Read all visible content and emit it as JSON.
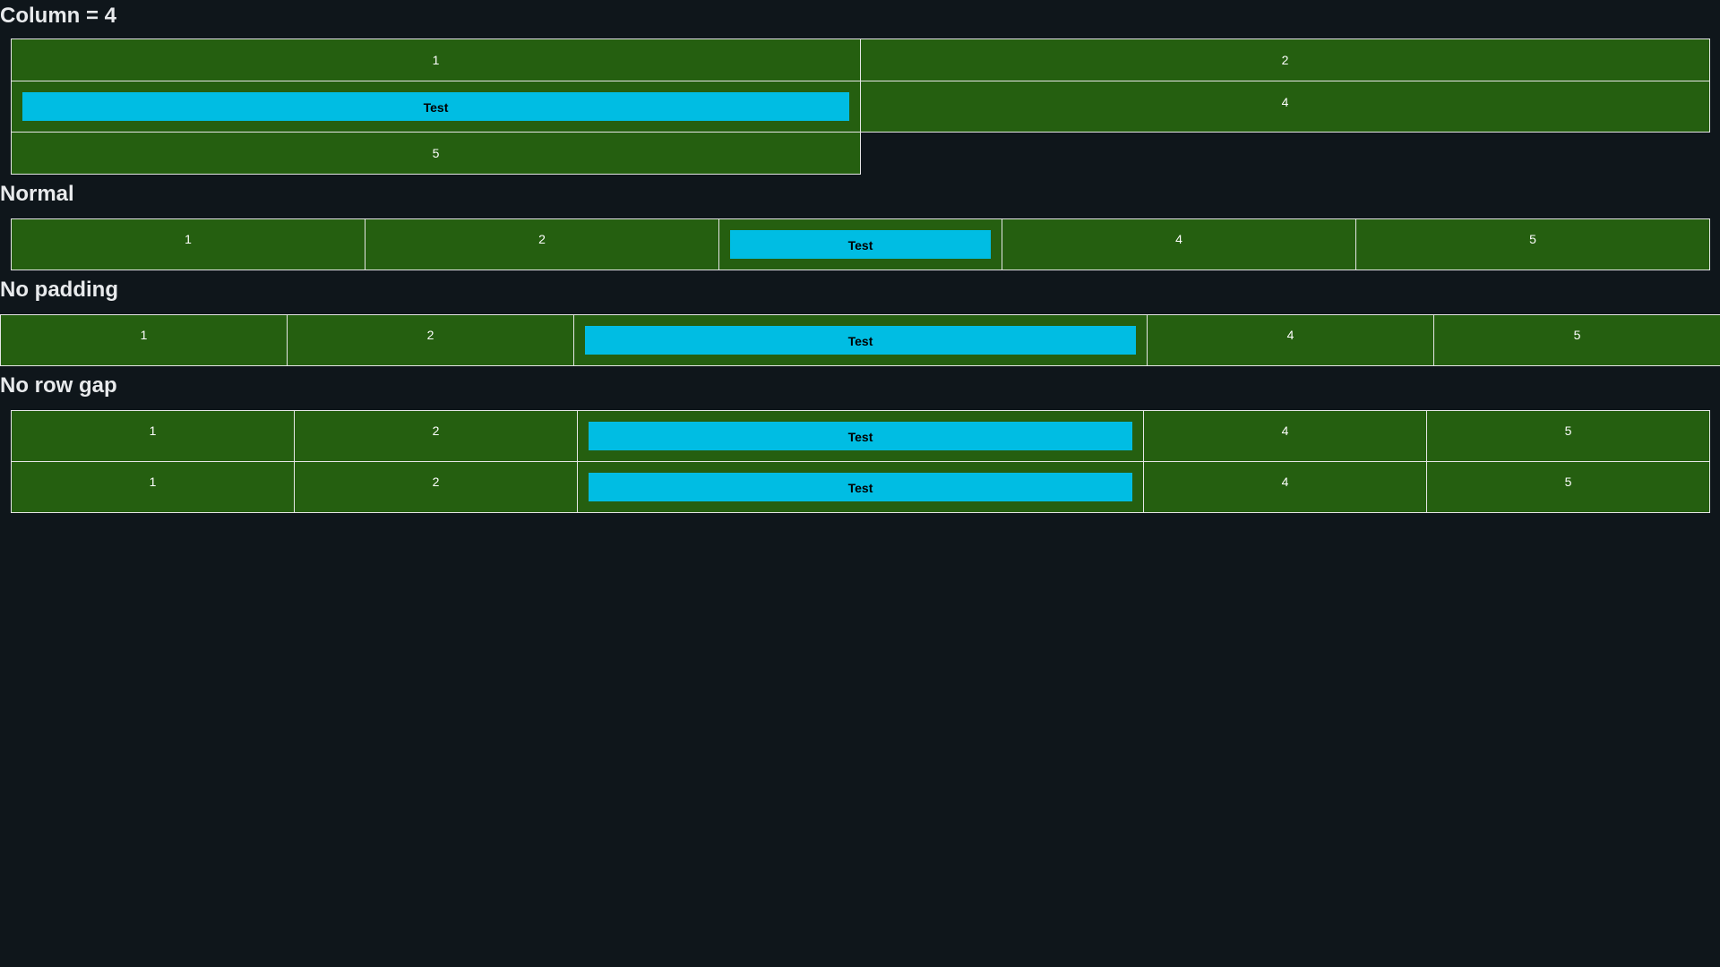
{
  "sections": [
    {
      "title": "Column = 4",
      "cells": [
        "1",
        "2",
        "Test",
        "4",
        "5"
      ]
    },
    {
      "title": "Normal",
      "cells": [
        "1",
        "2",
        "Test",
        "4",
        "5"
      ]
    },
    {
      "title": "No padding",
      "cells": [
        "1",
        "2",
        "Test",
        "4",
        "5"
      ]
    },
    {
      "title": "No row gap",
      "rows": [
        [
          "1",
          "2",
          "Test",
          "4",
          "5"
        ],
        [
          "1",
          "2",
          "Test",
          "4",
          "5"
        ]
      ]
    }
  ],
  "colors": {
    "background": "#0f161b",
    "cell": "#255f10",
    "button": "#00bde3",
    "border": "#e6e6e6"
  }
}
